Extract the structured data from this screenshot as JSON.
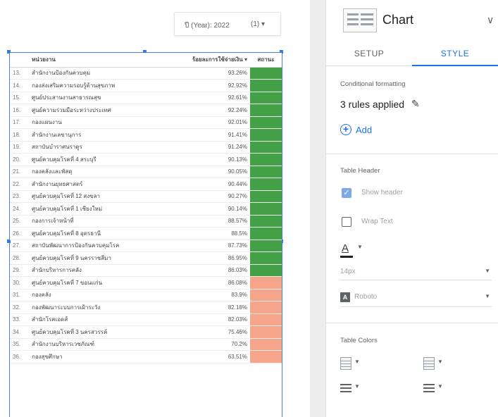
{
  "colors": {
    "good": "#43a047",
    "bad": "#f7a58a",
    "accent": "#1a73e8",
    "selection": "#4a80dd"
  },
  "date_control": {
    "label": "ปี (Year): 2022",
    "value": "(1) ▾"
  },
  "table": {
    "headers": [
      "",
      "หน่วยงาน",
      "ร้อยละการใช้จ่ายเงิน ▾",
      "สถานะ"
    ],
    "rows": [
      {
        "idx": "13.",
        "name": "สำนักงานป้องกันควบคุม",
        "pct": "93.26%",
        "status": "good"
      },
      {
        "idx": "14.",
        "name": "กองส่งเสริมความรอบรู้ด้านสุขภาพ",
        "pct": "92.92%",
        "status": "good"
      },
      {
        "idx": "15.",
        "name": "ศูนย์ประสานงานสาธารณสุข",
        "pct": "92.61%",
        "status": "good"
      },
      {
        "idx": "16.",
        "name": "ศูนย์ความร่วมมือระหว่างประเทศ",
        "pct": "92.24%",
        "status": "good"
      },
      {
        "idx": "17.",
        "name": "กองแผนงาน",
        "pct": "92.01%",
        "status": "good"
      },
      {
        "idx": "18.",
        "name": "สำนักงานเลขานุการ",
        "pct": "91.41%",
        "status": "good"
      },
      {
        "idx": "19.",
        "name": "สถาบันบำราศนราดูร",
        "pct": "91.24%",
        "status": "good"
      },
      {
        "idx": "20.",
        "name": "ศูนย์ควบคุมโรคที่ 4 สระบุรี",
        "pct": "90.13%",
        "status": "good"
      },
      {
        "idx": "21.",
        "name": "กองคลังและพัสดุ",
        "pct": "90.05%",
        "status": "good"
      },
      {
        "idx": "22.",
        "name": "สำนักงานยุทธศาสตร์",
        "pct": "90.44%",
        "status": "good"
      },
      {
        "idx": "23.",
        "name": "ศูนย์ควบคุมโรคที่ 12 สงขลา",
        "pct": "90.27%",
        "status": "good"
      },
      {
        "idx": "24.",
        "name": "ศูนย์ควบคุมโรคที่ 1 เชียงใหม่",
        "pct": "90.14%",
        "status": "good"
      },
      {
        "idx": "25.",
        "name": "กองการเจ้าหน้าที่",
        "pct": "88.57%",
        "status": "good"
      },
      {
        "idx": "26.",
        "name": "ศูนย์ควบคุมโรคที่ 8 อุดรธานี",
        "pct": "88.5%",
        "status": "good"
      },
      {
        "idx": "27.",
        "name": "สถาบันพัฒนาการป้องกันควบคุมโรค",
        "pct": "87.73%",
        "status": "good"
      },
      {
        "idx": "28.",
        "name": "ศูนย์ควบคุมโรคที่ 9 นครราชสีมา",
        "pct": "86.95%",
        "status": "good"
      },
      {
        "idx": "29.",
        "name": "สำนักบริหารการคลัง",
        "pct": "86.03%",
        "status": "good"
      },
      {
        "idx": "30.",
        "name": "ศูนย์ควบคุมโรคที่ 7 ขอนแก่น",
        "pct": "86.08%",
        "status": "bad"
      },
      {
        "idx": "31.",
        "name": "กองคลัง",
        "pct": "83.9%",
        "status": "bad"
      },
      {
        "idx": "32.",
        "name": "กองพัฒนาระบบการเฝ้าระวัง",
        "pct": "82.18%",
        "status": "bad"
      },
      {
        "idx": "33.",
        "name": "สำนักโรคเอดส์",
        "pct": "82.03%",
        "status": "bad"
      },
      {
        "idx": "34.",
        "name": "ศูนย์ควบคุมโรคที่ 3 นครสวรรค์",
        "pct": "75.46%",
        "status": "bad"
      },
      {
        "idx": "35.",
        "name": "สำนักงานบริหารเวชภัณฑ์",
        "pct": "70.2%",
        "status": "bad"
      },
      {
        "idx": "36.",
        "name": "กองสุขศึกษา",
        "pct": "63.51%",
        "status": "bad"
      }
    ]
  },
  "panel": {
    "title": "Chart",
    "chevron": "∨",
    "tabs": [
      "SETUP",
      "STYLE"
    ],
    "conditional_formatting": {
      "title": "Conditional formatting",
      "rules_text": "3 rules applied",
      "add_label": "Add"
    },
    "table_header": {
      "title": "Table Header",
      "show_header_label": "Show header",
      "wrap_text_label": "Wrap Text",
      "font_size": "14px",
      "font_family": "Roboto"
    },
    "table_colors": {
      "title": "Table Colors"
    }
  }
}
